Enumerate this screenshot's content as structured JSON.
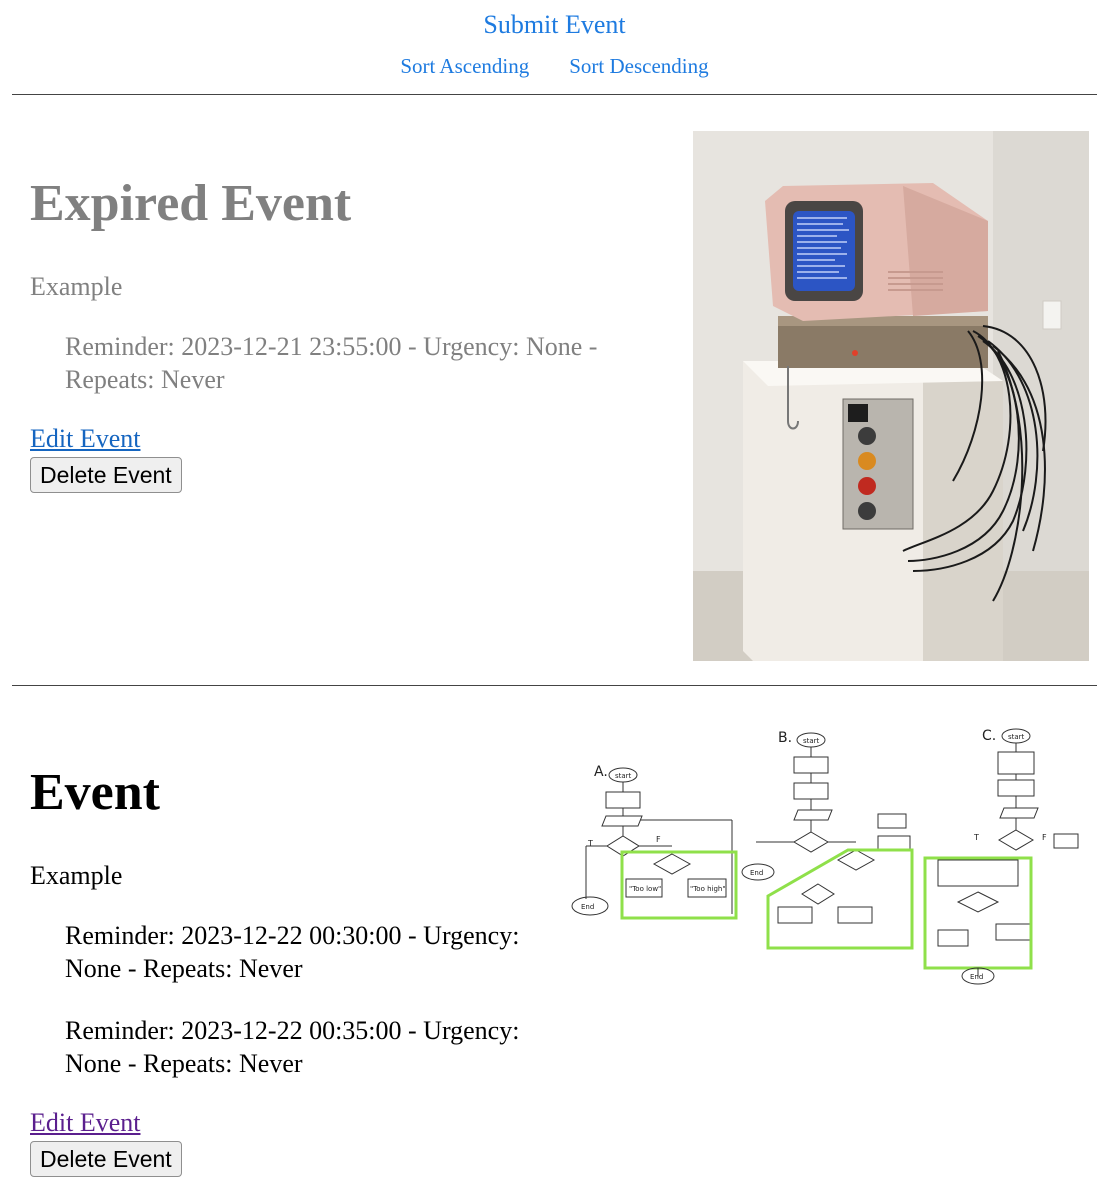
{
  "nav": {
    "submit_label": "Submit Event",
    "sort_ascending_label": "Sort Ascending",
    "sort_descending_label": "Sort Descending"
  },
  "events": [
    {
      "title": "Expired Event",
      "description": "Example",
      "reminders": [
        "Reminder: 2023-12-21 23:55:00 - Urgency: None - Repeats: Never"
      ],
      "edit_label": "Edit Event",
      "delete_label": "Delete Event",
      "status": "expired"
    },
    {
      "title": "Event",
      "description": "Example",
      "reminders": [
        "Reminder: 2023-12-22 00:30:00 - Urgency: None - Repeats: Never",
        "Reminder: 2023-12-22 00:35:00 - Urgency: None - Repeats: Never"
      ],
      "edit_label": "Edit Event",
      "delete_label": "Delete Event",
      "status": "active"
    }
  ],
  "flowchart": {
    "labels": {
      "panel_a": "A.",
      "panel_b": "B.",
      "panel_c": "C.",
      "start": "start",
      "end": "End",
      "too_low": "\"Too low\"",
      "too_high": "\"Too high\"",
      "t": "T",
      "f": "F"
    }
  },
  "colors": {
    "link": "#1e7be0",
    "expired_text": "#808080",
    "visited_link": "#5b1f8e",
    "highlight_green": "#8fe04a"
  }
}
